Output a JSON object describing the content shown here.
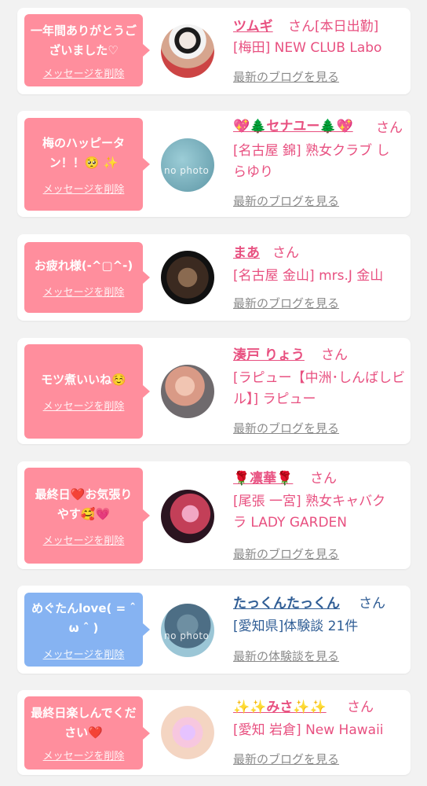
{
  "entries": [
    {
      "message": "一年間ありがとうございました♡",
      "delete_label": "メッセージを削除",
      "avatar": "photo",
      "name": "ツムギ",
      "suffix": "さん[本日出勤]",
      "shop": "[梅田] NEW CLUB Labo",
      "link": "最新のブログを見る",
      "bubble_color": "#ff8e9d"
    },
    {
      "message": "梅のハッピータン！！🥺 ✨",
      "delete_label": "メッセージを削除",
      "avatar": "no photo",
      "name": "💖🌲セナユー🌲💖",
      "suffix": "さん",
      "shop": "[名古屋 錦] 熟女クラブ しらゆり",
      "link": "最新のブログを見る",
      "bubble_color": "#ff8e9d"
    },
    {
      "message": "お疲れ様(-^▢^-)",
      "delete_label": "メッセージを削除",
      "avatar": "photo",
      "name": "まあ",
      "suffix": "さん",
      "shop": "[名古屋 金山] mrs.J 金山",
      "link": "最新のブログを見る",
      "bubble_color": "#ff8e9d"
    },
    {
      "message": "モツ煮いいね☺️",
      "delete_label": "メッセージを削除",
      "avatar": "photo",
      "name": "湊戸 りょう",
      "suffix": "さん",
      "shop": "[ラピュー【中洲･しんばしビル】] ラピュー",
      "link": "最新のブログを見る",
      "bubble_color": "#ff8e9d"
    },
    {
      "message": "最終日❤️お気張りやす🥰💗",
      "delete_label": "メッセージを削除",
      "avatar": "photo",
      "name": "🌹凛華🌹",
      "suffix": "さん",
      "shop": "[尾張 一宮] 熟女キャバクラ LADY GARDEN",
      "link": "最新のブログを見る",
      "bubble_color": "#ff8e9d"
    },
    {
      "message": "めぐたんlove( = ˆ ω ˆ )",
      "delete_label": "メッセージを削除",
      "avatar": "no photo",
      "name": "たっくんたっくん",
      "suffix": "さん",
      "shop": "[愛知県]体験談 21件",
      "link": "最新の体験談を見る",
      "bubble_color": "#86b3f2"
    },
    {
      "message": "最終日楽しんでください❤️",
      "delete_label": "メッセージを削除",
      "avatar": "photo",
      "name": "✨✨みさ✨✨",
      "suffix": "さん",
      "shop": "[愛知 岩倉] New Hawaii",
      "link": "最新のブログを見る",
      "bubble_color": "#ff8e9d"
    }
  ]
}
